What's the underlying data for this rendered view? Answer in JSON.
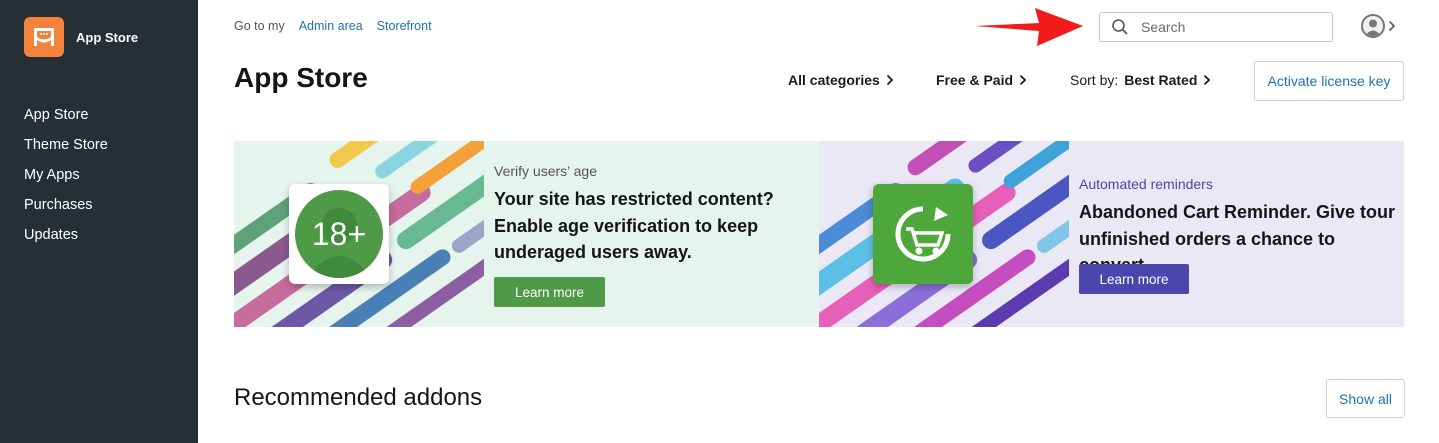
{
  "sidebar": {
    "app_name": "App Store",
    "items": [
      {
        "label": "App Store"
      },
      {
        "label": "Theme Store"
      },
      {
        "label": "My Apps"
      },
      {
        "label": "Purchases"
      },
      {
        "label": "Updates"
      }
    ]
  },
  "header": {
    "goto_label": "Go to my",
    "links": [
      {
        "label": "Admin area"
      },
      {
        "label": "Storefront"
      }
    ],
    "search_placeholder": "Search"
  },
  "page": {
    "title": "App Store",
    "filters": {
      "categories": "All categories",
      "pricing": "Free & Paid",
      "sort_prefix": "Sort by:",
      "sort_value": "Best Rated"
    },
    "license_button": "Activate license key"
  },
  "banners": [
    {
      "kicker": "Verify users’ age",
      "headline_lines": [
        "Your site has restricted content?",
        "Enable age verification to keep",
        "underaged users away."
      ],
      "button": "Learn more",
      "badge": "18+",
      "accent": "#4f9a47"
    },
    {
      "kicker": "Automated reminders",
      "headline_lines": [
        "Abandoned Cart Reminder. Give tour",
        "unfinished orders a chance to convert."
      ],
      "button": "Learn more",
      "icon": "cart-refresh-icon",
      "accent": "#4a46ad"
    }
  ],
  "recommended": {
    "title": "Recommended addons",
    "show_all": "Show all"
  },
  "colors": {
    "sidebar_bg": "#252f35",
    "brand_orange": "#f3823a",
    "link_blue": "#2070b8",
    "annotation_arrow": "#f21a1a"
  }
}
